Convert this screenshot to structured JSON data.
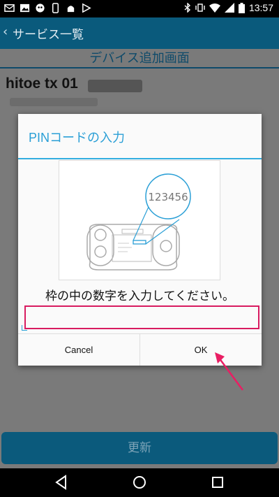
{
  "status_bar": {
    "time": "13:57",
    "icons_left": [
      "mail-icon",
      "image-icon",
      "messenger-icon",
      "phone-icon",
      "android-icon",
      "play-store-icon"
    ],
    "icons_right": [
      "bluetooth-icon",
      "vibrate-icon",
      "wifi-icon",
      "signal-icon",
      "battery-icon"
    ]
  },
  "app_bar": {
    "back_label": "サービス一覧"
  },
  "page": {
    "screen_title": "デバイス追加画面",
    "device_name": "hitoe tx 01",
    "update_button": "更新"
  },
  "dialog": {
    "title": "PINコードの入力",
    "image_pin": "123456",
    "message": "枠の中の数字を入力してください。",
    "input_value": "",
    "input_placeholder": "",
    "cancel_label": "Cancel",
    "ok_label": "OK"
  },
  "colors": {
    "accent": "#2a9fd6",
    "input_border": "#d81b60",
    "app_bar": "#0a5a7c"
  }
}
